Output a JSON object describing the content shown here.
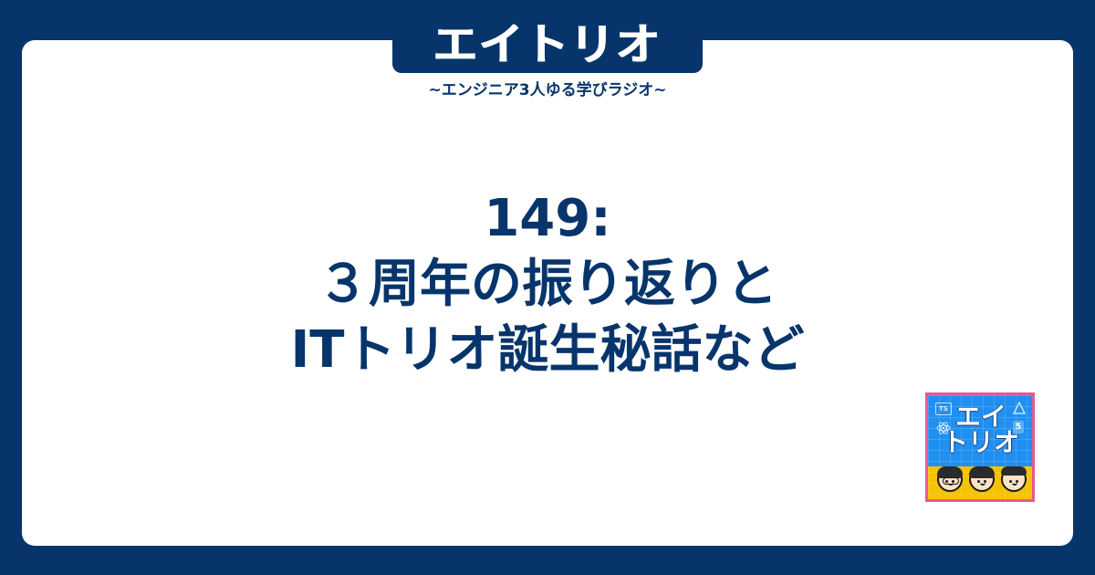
{
  "brand": {
    "logo_text": "エイトリオ",
    "tagline": "~エンジニア3人ゆる学びラジオ~"
  },
  "episode": {
    "title_lines": [
      "149:",
      "３周年の振り返りと",
      "ITトリオ誕生秘話など"
    ]
  },
  "badge": {
    "title_line1": "エイ",
    "title_line2": "トリオ",
    "ts_label": "TS",
    "five_label": "5"
  },
  "colors": {
    "navy": "#07356b",
    "white": "#ffffff",
    "blue": "#1f8ff0",
    "yellow": "#f5c200",
    "pink_border": "#e45b93"
  }
}
